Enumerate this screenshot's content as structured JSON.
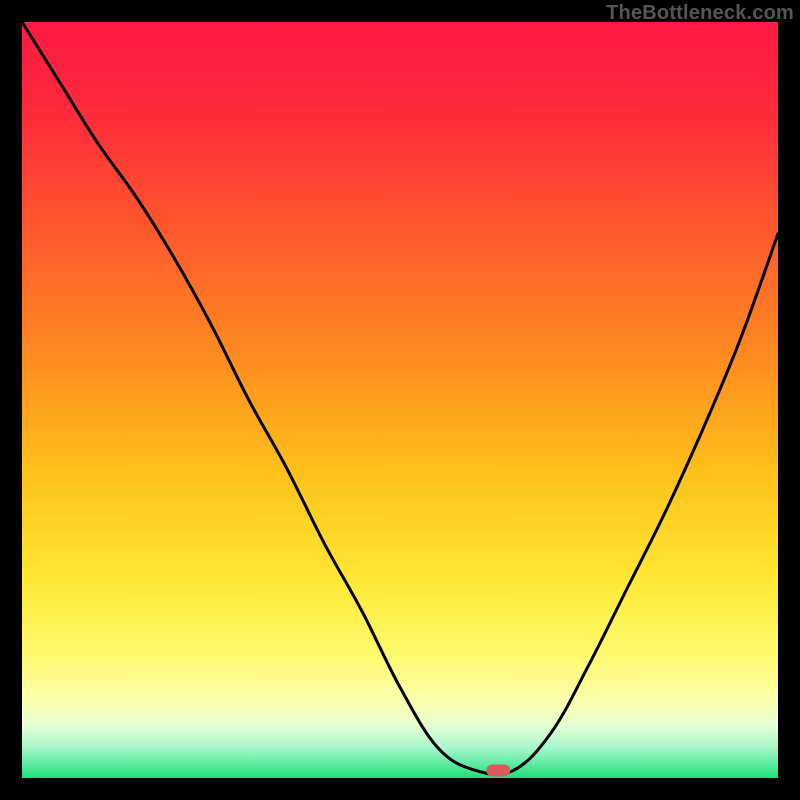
{
  "watermark": "TheBottleneck.com",
  "chart_data": {
    "type": "line",
    "title": "",
    "xlabel": "",
    "ylabel": "",
    "xlim": [
      0,
      100
    ],
    "ylim": [
      0,
      100
    ],
    "x": [
      0,
      5,
      10,
      15,
      20,
      25,
      30,
      35,
      40,
      45,
      50,
      55,
      60,
      65,
      70,
      75,
      80,
      85,
      90,
      95,
      100
    ],
    "values": [
      100,
      92,
      84,
      77,
      69,
      60,
      50,
      41,
      31,
      22,
      12,
      4,
      1,
      1,
      6,
      15,
      25,
      35,
      46,
      58,
      72
    ],
    "minimum_marker": {
      "x": 63,
      "y": 1
    },
    "gradient_stops": [
      {
        "pos": 0.0,
        "color": "#ff1a44"
      },
      {
        "pos": 0.12,
        "color": "#ff2a3a"
      },
      {
        "pos": 0.28,
        "color": "#ff5a2d"
      },
      {
        "pos": 0.44,
        "color": "#ff8a20"
      },
      {
        "pos": 0.6,
        "color": "#ffc21a"
      },
      {
        "pos": 0.74,
        "color": "#ffe934"
      },
      {
        "pos": 0.84,
        "color": "#fffb70"
      },
      {
        "pos": 0.9,
        "color": "#fbffb0"
      },
      {
        "pos": 0.93,
        "color": "#e6ffd2"
      },
      {
        "pos": 0.96,
        "color": "#a7f7cc"
      },
      {
        "pos": 1.0,
        "color": "#1fe07a"
      }
    ]
  }
}
